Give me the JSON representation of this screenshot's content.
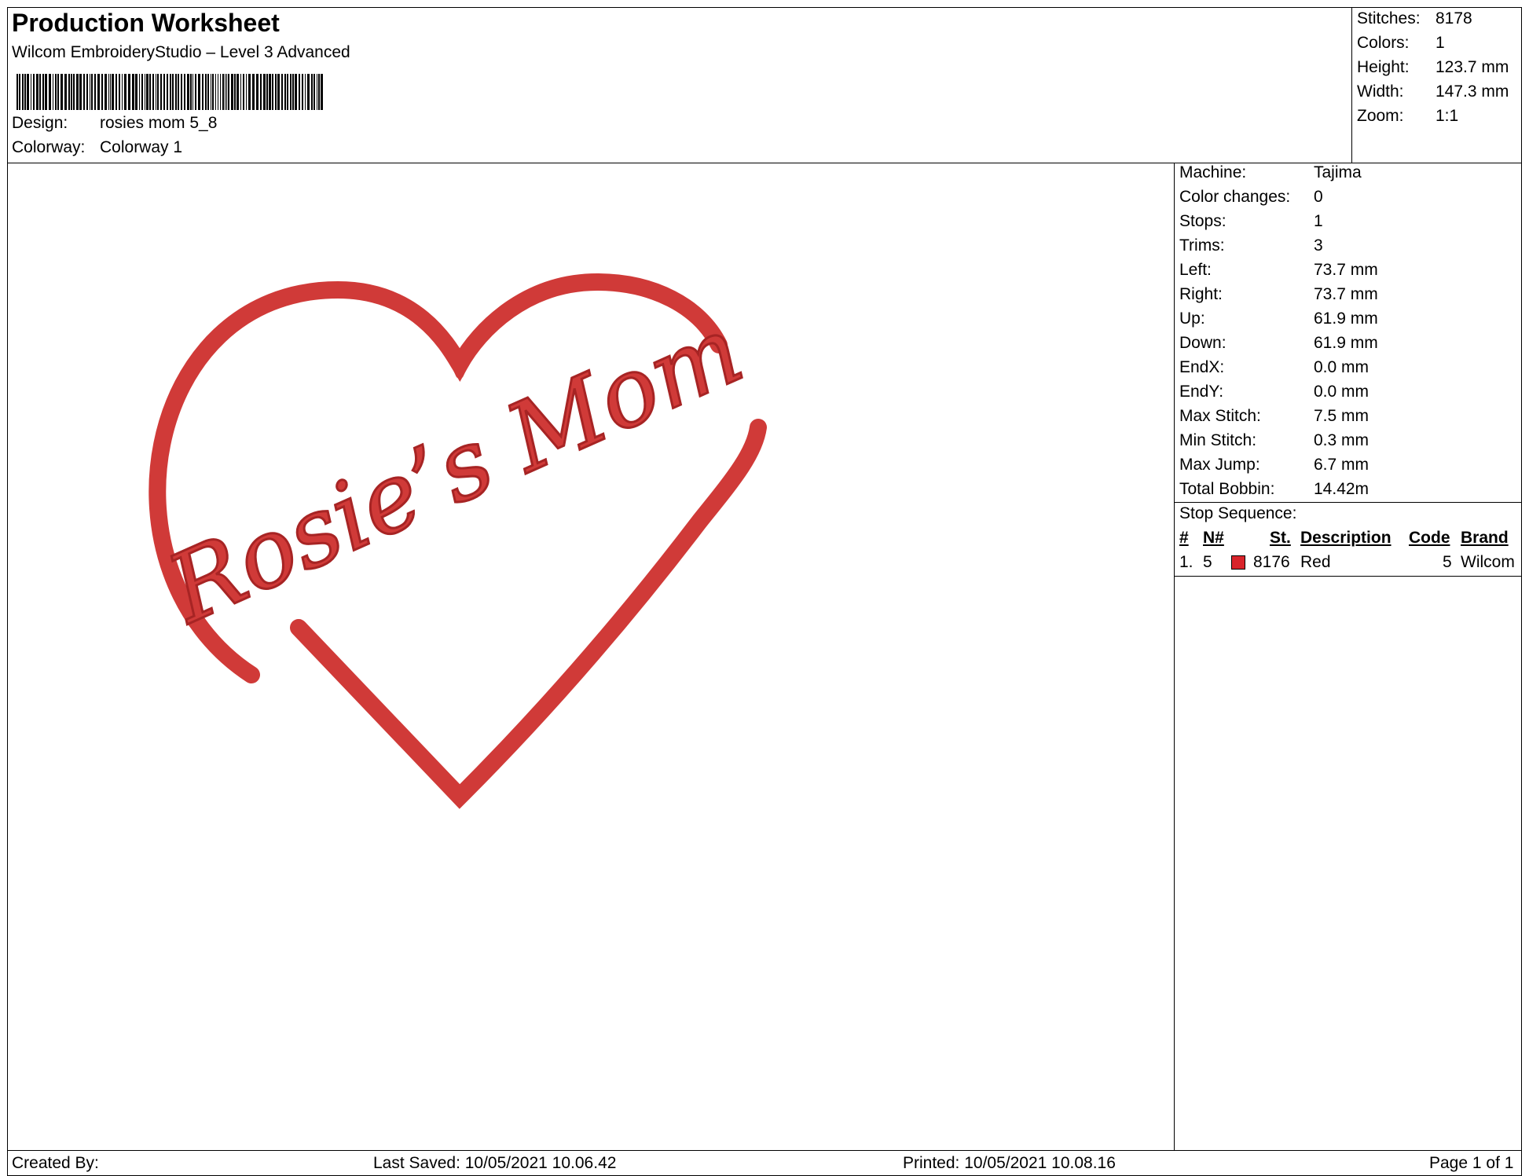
{
  "header": {
    "title": "Production Worksheet",
    "software": "Wilcom EmbroideryStudio – Level 3 Advanced",
    "design_label": "Design:",
    "design_value": "rosies mom 5_8",
    "colorway_label": "Colorway:",
    "colorway_value": "Colorway 1"
  },
  "summary": [
    {
      "label": "Stitches:",
      "value": "8178"
    },
    {
      "label": "Colors:",
      "value": "1"
    },
    {
      "label": "Height:",
      "value": "123.7 mm"
    },
    {
      "label": "Width:",
      "value": "147.3 mm"
    },
    {
      "label": "Zoom:",
      "value": "1:1"
    }
  ],
  "details": [
    {
      "label": "Machine:",
      "value": "Tajima"
    },
    {
      "label": "Color changes:",
      "value": "0"
    },
    {
      "label": "Stops:",
      "value": "1"
    },
    {
      "label": "Trims:",
      "value": "3"
    },
    {
      "label": "Left:",
      "value": "73.7 mm"
    },
    {
      "label": "Right:",
      "value": "73.7 mm"
    },
    {
      "label": "Up:",
      "value": "61.9 mm"
    },
    {
      "label": "Down:",
      "value": "61.9 mm"
    },
    {
      "label": "EndX:",
      "value": "0.0 mm"
    },
    {
      "label": "EndY:",
      "value": "0.0 mm"
    },
    {
      "label": "Max Stitch:",
      "value": "7.5 mm"
    },
    {
      "label": "Min Stitch:",
      "value": "0.3 mm"
    },
    {
      "label": "Max Jump:",
      "value": "6.7 mm"
    },
    {
      "label": "Total Bobbin:",
      "value": "14.42m"
    }
  ],
  "stop_sequence": {
    "title": "Stop Sequence:",
    "columns": {
      "num": "#",
      "needle": "N#",
      "stitches": "St.",
      "description": "Description",
      "code": "Code",
      "brand": "Brand"
    },
    "rows": [
      {
        "num": "1.",
        "needle": "5",
        "color": "#d9242b",
        "stitches": "8176",
        "description": "Red",
        "code": "5",
        "brand": "Wilcom"
      }
    ]
  },
  "design_preview": {
    "text": "Rosie’s Mom",
    "thread_color": "#d03a38",
    "thread_shadow": "#a72424"
  },
  "footer": {
    "created_by": "Created By:",
    "last_saved": "Last Saved: 10/05/2021 10.06.42",
    "printed": "Printed: 10/05/2021 10.08.16",
    "page": "Page 1 of 1"
  }
}
